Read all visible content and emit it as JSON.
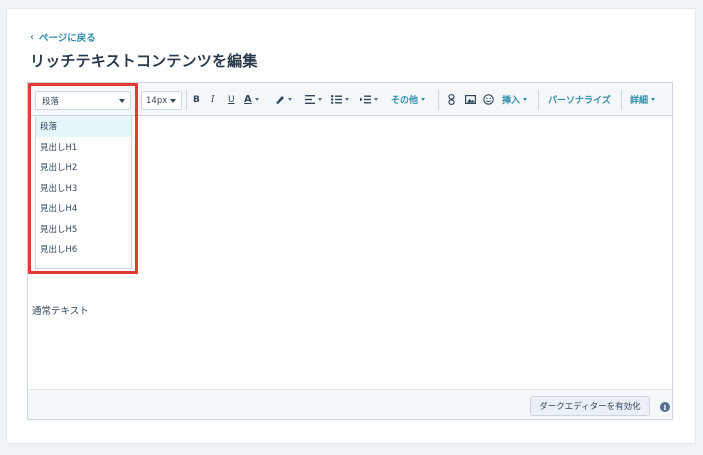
{
  "nav": {
    "back_label": "ページに戻る"
  },
  "page": {
    "title": "リッチテキストコンテンツを編集"
  },
  "toolbar": {
    "block_format": "段落",
    "font_size": "14px",
    "bold_label": "B",
    "italic_label": "I",
    "underline_label": "U",
    "text_color_label": "A",
    "other_label": "その他",
    "insert_label": "挿入",
    "personalize_label": "パーソナライズ",
    "details_label": "詳細"
  },
  "dropdown": {
    "items": [
      "段落",
      "見出しH1",
      "見出しH2",
      "見出しH3",
      "見出しH4",
      "見出しH5",
      "見出しH6"
    ],
    "selected": "段落"
  },
  "content": {
    "text": "通常テキスト"
  },
  "footer": {
    "dark_editor_label": "ダークエディターを有効化",
    "info_label": "i"
  },
  "colors": {
    "accent": "#2e8dab",
    "highlight": "#e53935"
  }
}
